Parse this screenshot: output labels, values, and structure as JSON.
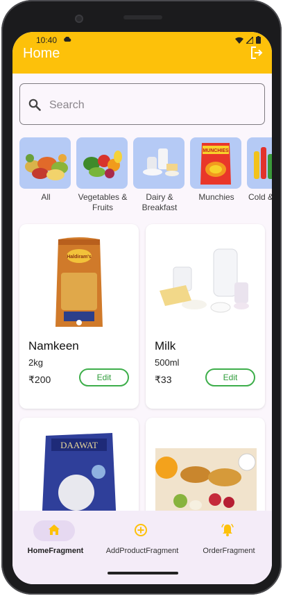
{
  "status_bar": {
    "time": "10:40"
  },
  "app_bar": {
    "title": "Home"
  },
  "search": {
    "placeholder": "Search"
  },
  "categories": [
    {
      "label": "All"
    },
    {
      "label": "Vegetables & Fruits"
    },
    {
      "label": "Dairy & Breakfast"
    },
    {
      "label": "Munchies"
    },
    {
      "label": "Cold & J"
    }
  ],
  "products": [
    {
      "name": "Namkeen",
      "quantity": "2kg",
      "price": "₹200",
      "edit_label": "Edit"
    },
    {
      "name": "Milk",
      "quantity": "500ml",
      "price": "₹33",
      "edit_label": "Edit"
    },
    {
      "name": "",
      "quantity": "",
      "price": "",
      "edit_label": ""
    },
    {
      "name": "",
      "quantity": "",
      "price": "",
      "edit_label": ""
    }
  ],
  "package_text": {
    "haldiram": "Haldiram's",
    "munchies": "MUNCHIES",
    "daawat": "DAAWAT"
  },
  "bottom_nav": [
    {
      "label": "HomeFragment",
      "icon": "home-icon"
    },
    {
      "label": "AddProductFragment",
      "icon": "add-circle-icon"
    },
    {
      "label": "OrderFragment",
      "icon": "bell-icon"
    }
  ],
  "colors": {
    "accent": "#fdc10a",
    "edit_green": "#3dae4a",
    "category_bg": "#b5caf5",
    "nav_bg": "#f4ecf8"
  }
}
